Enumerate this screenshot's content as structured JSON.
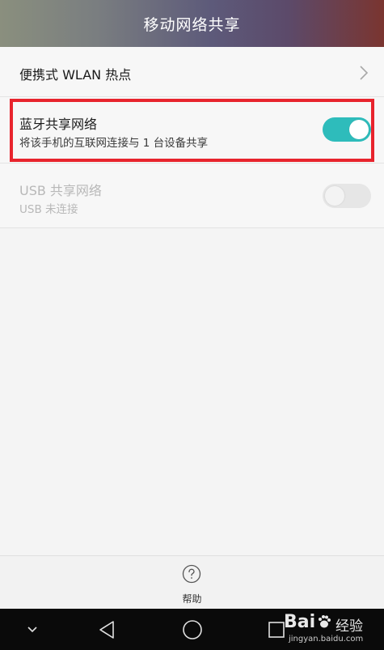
{
  "header": {
    "title": "移动网络共享"
  },
  "settings": {
    "wlan_hotspot": {
      "title": "便携式 WLAN 热点"
    },
    "bluetooth_tethering": {
      "title": "蓝牙共享网络",
      "subtitle": "将该手机的互联网连接与 1 台设备共享",
      "enabled": true
    },
    "usb_tethering": {
      "title": "USB 共享网络",
      "subtitle": "USB 未连接",
      "enabled": false
    }
  },
  "help": {
    "label": "帮助"
  },
  "watermark": {
    "logo": "Bai",
    "text": "经验",
    "domain": "jingyan.baidu.com"
  },
  "colors": {
    "toggle_on": "#2ebcbb",
    "highlight_border": "#e8242d",
    "nav_bar": "#0a0a0a"
  }
}
